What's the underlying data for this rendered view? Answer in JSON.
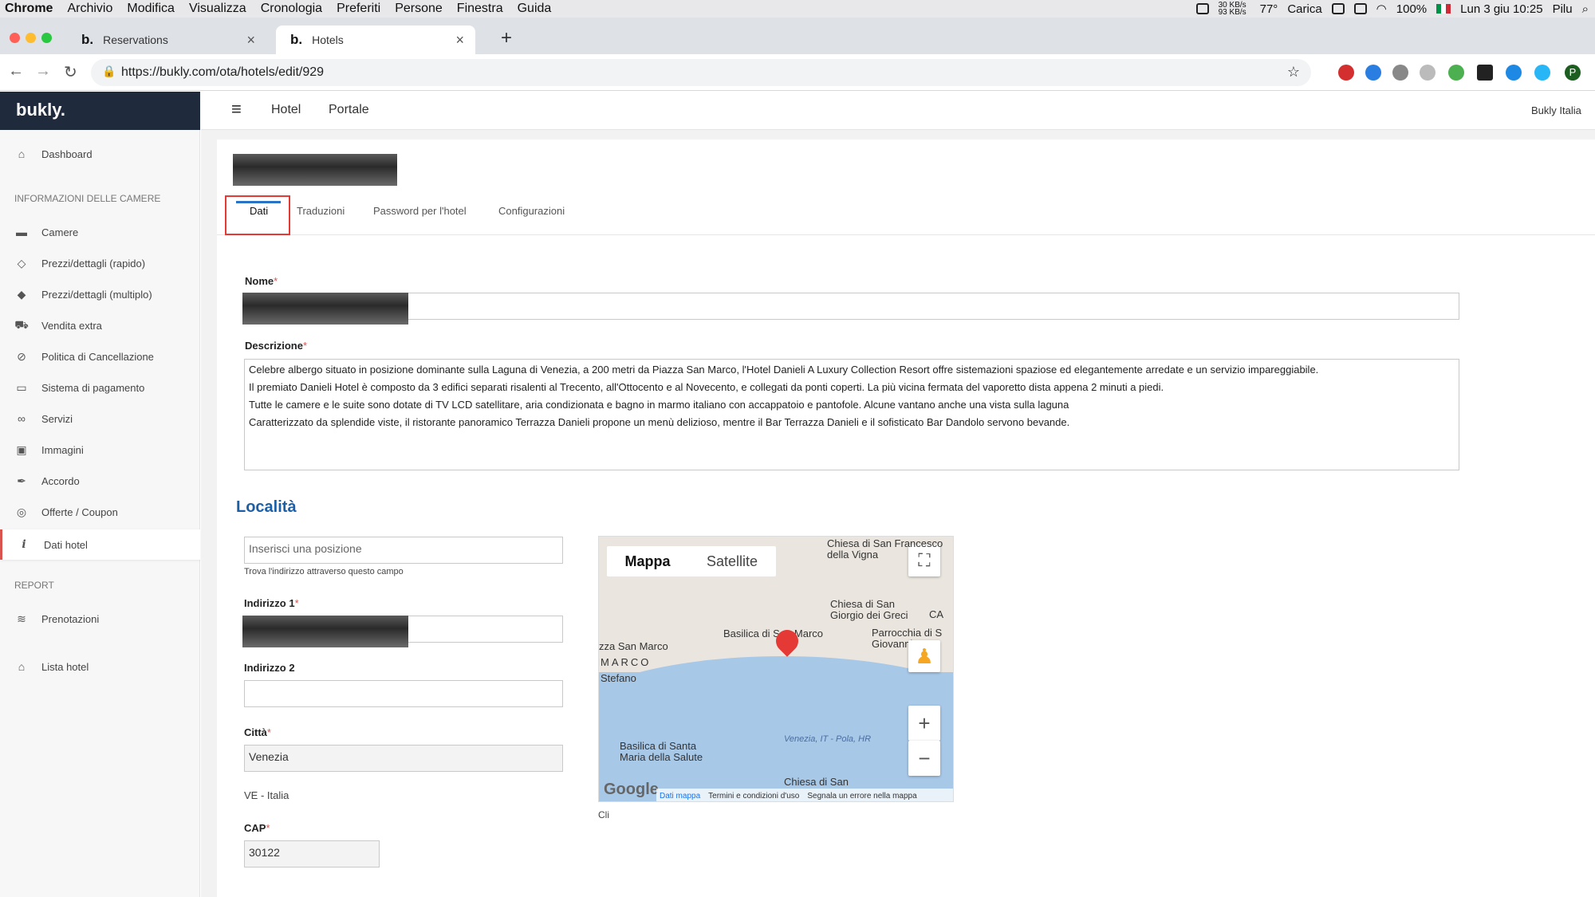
{
  "macbar": {
    "app": "Chrome",
    "menus": [
      "Archivio",
      "Modifica",
      "Visualizza",
      "Cronologia",
      "Preferiti",
      "Persone",
      "Finestra",
      "Guida"
    ],
    "net_speed": "30 KB/s 93 KB/s",
    "temperature": "77°",
    "charge": "Carica",
    "battery": "100%",
    "datetime": "Lun 3 giu 10:25",
    "user": "Pilu"
  },
  "browser": {
    "tabs": [
      {
        "label": "Reservations",
        "favicon": "b."
      },
      {
        "label": "Hotels",
        "favicon": "b."
      }
    ],
    "url": "https://bukly.com/ota/hotels/edit/929",
    "profile_initial": "P"
  },
  "sidebar": {
    "logo": "bukly.",
    "dashboard": "Dashboard",
    "section_rooms": "INFORMAZIONI DELLE CAMERE",
    "items": [
      {
        "label": "Camere",
        "icon": "bed-icon"
      },
      {
        "label": "Prezzi/dettagli (rapido)",
        "icon": "tag-icon"
      },
      {
        "label": "Prezzi/dettagli (multiplo)",
        "icon": "tags-icon"
      },
      {
        "label": "Vendita extra",
        "icon": "cart-icon"
      },
      {
        "label": "Politica di Cancellazione",
        "icon": "ban-icon"
      },
      {
        "label": "Sistema di pagamento",
        "icon": "credit-card-icon"
      },
      {
        "label": "Servizi",
        "icon": "binoculars-icon"
      },
      {
        "label": "Immagini",
        "icon": "image-icon"
      },
      {
        "label": "Accordo",
        "icon": "pen-icon"
      },
      {
        "label": "Offerte / Coupon",
        "icon": "target-icon"
      },
      {
        "label": "Dati hotel",
        "icon": "info-icon"
      }
    ],
    "section_report": "REPORT",
    "report_items": [
      {
        "label": "Prenotazioni",
        "icon": "layers-icon"
      },
      {
        "label": "Lista hotel",
        "icon": "hotel-icon"
      }
    ]
  },
  "topbar": {
    "links": [
      "Hotel",
      "Portale"
    ],
    "account": "Bukly Italia"
  },
  "page": {
    "tabs": [
      "Dati",
      "Traduzioni",
      "Password per l'hotel",
      "Configurazioni"
    ],
    "active_tab": "Dati",
    "name_label": "Nome",
    "desc_label": "Descrizione",
    "description": [
      "Celebre albergo situato in posizione dominante sulla Laguna di Venezia, a 200 metri da Piazza San Marco, l'Hotel Danieli A Luxury Collection Resort offre sistemazioni spaziose ed elegantemente arredate e un servizio impareggiabile.",
      "Il premiato Danieli Hotel è composto da 3 edifici separati risalenti al Trecento, all'Ottocento e al Novecento, e collegati da ponti coperti. La più vicina fermata del vaporetto dista appena 2 minuti a piedi.",
      "Tutte le camere e le suite sono dotate di TV LCD satellitare, aria condizionata e bagno in marmo italiano con accappatoio e pantofole. Alcune vantano anche una vista sulla laguna",
      "Caratterizzato da splendide viste, il ristorante panoramico Terrazza Danieli propone un menù delizioso, mentre il Bar Terrazza Danieli e il sofisticato Bar Dandolo servono bevande."
    ],
    "location_title": "Località",
    "position_placeholder": "Inserisci una posizione",
    "position_help": "Trova l'indirizzo attraverso questo campo",
    "address1_label": "Indirizzo 1",
    "address2_label": "Indirizzo 2",
    "city_label": "Città",
    "city_value": "Venezia",
    "region": "VE - Italia",
    "cap_label": "CAP",
    "cap_value": "30122",
    "map_caption": "Cli"
  },
  "map": {
    "tab_map": "Mappa",
    "tab_satellite": "Satellite",
    "labels": [
      "Chiesa di San Francesco della Vigna",
      "Chiesa di San Giorgio dei Greci",
      "Basilica di San Marco",
      "Parrocchia di S Giovanni",
      "zza San Marco",
      "MARCO",
      "Stefano",
      "Basilica di Santa Maria della Salute",
      "Chiesa di San",
      "Venezia, IT - Pola, HR",
      "CA"
    ],
    "footer": [
      "Dati mappa",
      "Termini e condizioni d'uso",
      "Segnala un errore nella mappa"
    ],
    "google": "Google"
  }
}
